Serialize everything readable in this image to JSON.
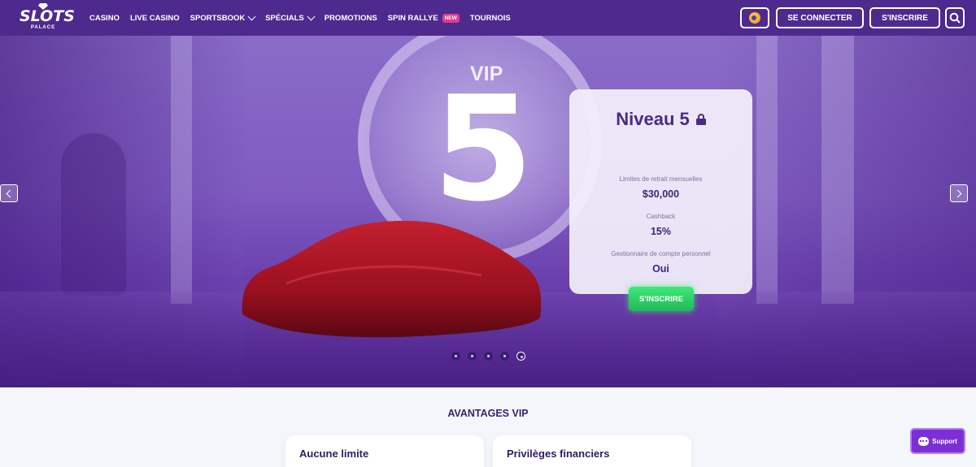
{
  "brand": {
    "name": "SLOTS",
    "sub": "PALACE"
  },
  "nav": [
    {
      "label": "CASINO",
      "dropdown": false
    },
    {
      "label": "LIVE CASINO",
      "dropdown": false
    },
    {
      "label": "SPORTSBOOK",
      "dropdown": true
    },
    {
      "label": "SPÉCIALS",
      "dropdown": true
    },
    {
      "label": "PROMOTIONS",
      "dropdown": false
    },
    {
      "label": "SPIN RALLYE",
      "dropdown": false,
      "badge": "NEW"
    },
    {
      "label": "TOURNOIS",
      "dropdown": false
    }
  ],
  "header": {
    "login_label": "SE CONNECTER",
    "signup_label": "S'INSCRIRE",
    "icons": [
      "coin-icon",
      "search-icon"
    ]
  },
  "hero": {
    "vip_label": "VIP",
    "level_number": "5",
    "card": {
      "title": "Niveau 5",
      "rows": [
        {
          "label": "Limites de retrait mensuelles",
          "value": "$30,000"
        },
        {
          "label": "Cashback",
          "value": "15%"
        },
        {
          "label": "Gestionnaire de compte personnel",
          "value": "Oui"
        }
      ],
      "cta_label": "S'INSCRIRE"
    },
    "slides": 5,
    "active_slide": 5
  },
  "benefits": {
    "title": "AVANTAGES VIP",
    "cards": [
      {
        "title": "Aucune limite"
      },
      {
        "title": "Privilèges financiers"
      }
    ]
  },
  "support": {
    "label": "Support"
  },
  "colors": {
    "header": "#4e2a8e",
    "accent_green": "#1fb957",
    "support": "#7d2fd6",
    "title": "#4b2a85"
  }
}
